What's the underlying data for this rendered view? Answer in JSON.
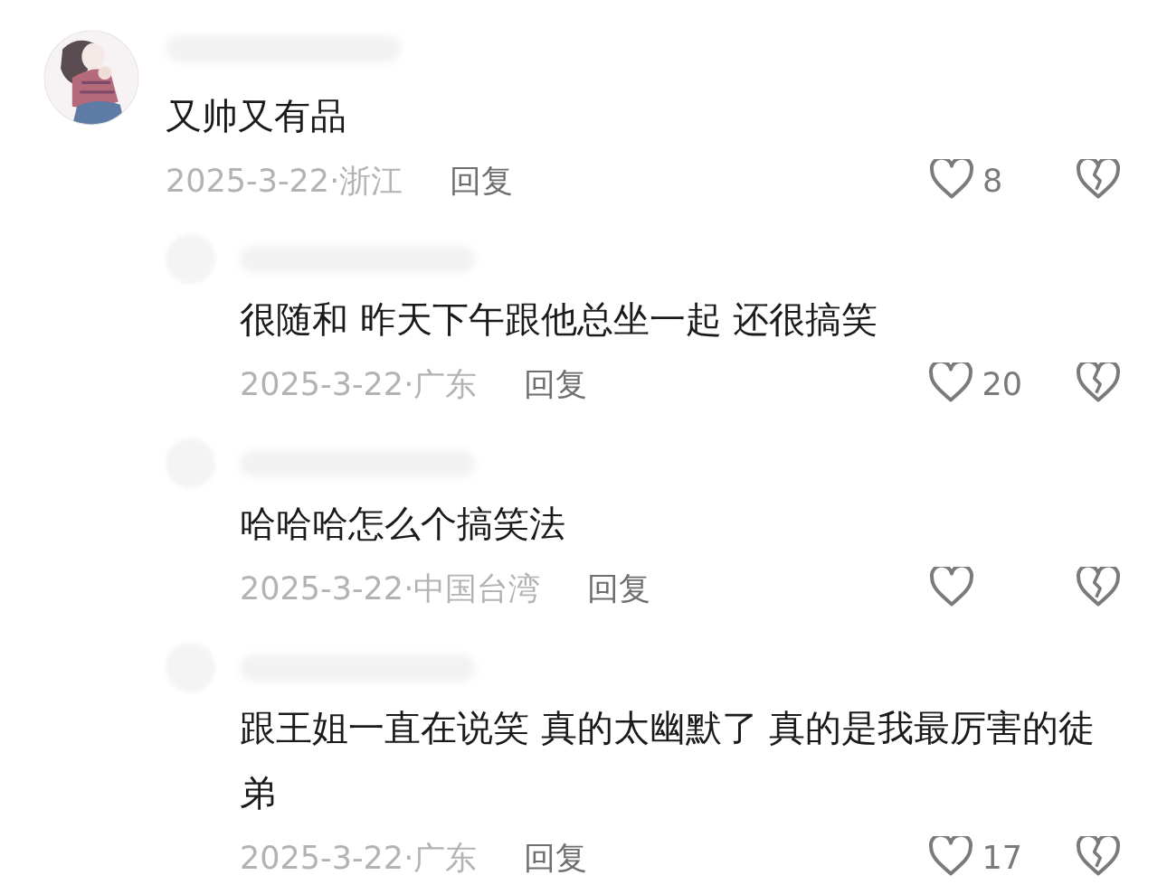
{
  "comment": {
    "text": "又帅又有品",
    "meta": "2025-3-22·浙江",
    "reply_label": "回复",
    "likes": "8",
    "replies": [
      {
        "text": "很随和 昨天下午跟他总坐一起 还很搞笑",
        "meta": "2025-3-22·广东",
        "reply_label": "回复",
        "likes": "20"
      },
      {
        "text": "哈哈哈怎么个搞笑法",
        "meta": "2025-3-22·中国台湾",
        "reply_label": "回复"
      },
      {
        "text": "跟王姐一直在说笑 真的太幽默了 真的是我最厉害的徒弟",
        "meta": "2025-3-22·广东",
        "reply_label": "回复",
        "likes": "17"
      }
    ]
  }
}
